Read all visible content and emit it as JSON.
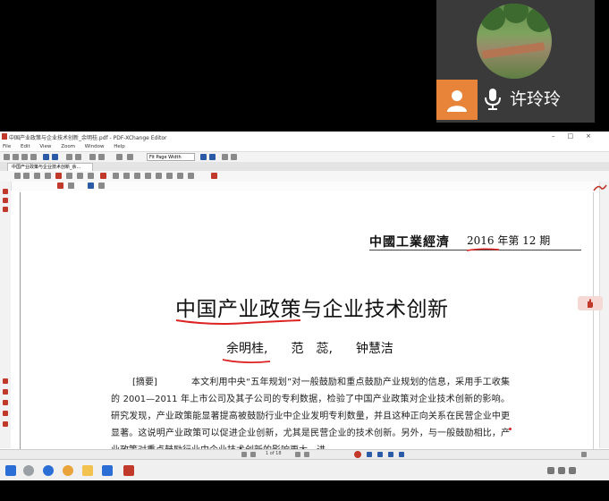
{
  "call": {
    "participant_name": "许玲玲",
    "avatar_icon": "person-icon",
    "mic_icon": "microphone-icon",
    "accent_color": "#e8833a"
  },
  "window": {
    "title": "中国产业政策与企业技术创新_余明桂.pdf - PDF-XChange Editor",
    "controls": [
      "–",
      "□",
      "×"
    ],
    "menu": [
      "File",
      "Edit",
      "View",
      "Zoom",
      "Window",
      "Help"
    ],
    "zoom_value": "Fit Page Width",
    "tab_label": "中国产业政策与企业技术创新_余..."
  },
  "document": {
    "journal_name": "中國工業經濟",
    "journal_issue": "2016 年第 12 期",
    "title": "中国产业政策与企业技术创新",
    "authors": [
      "余明桂,",
      "范　蕊,",
      "钟慧洁"
    ],
    "abstract_label": "[摘要]",
    "abstract_text": "本文利用中央“五年规划”对一般鼓励和重点鼓励产业规划的信息，采用手工收集的 2001—2011 年上市公司及其子公司的专利数据，检验了中国产业政策对企业技术创新的影响。研究发现，产业政策能显著提高被鼓励行业中企业发明专利数量，并且这种正向关系在民营企业中更显著。这说明产业政策可以促进企业创新，尤其是民营企业的技术创新。另外，与一般鼓励相比，产业政策对重点鼓励行业中企业技术创新的影响更大，进"
  },
  "status": {
    "page_nav": "1 of 18"
  },
  "annotation_color": "#c0392b"
}
